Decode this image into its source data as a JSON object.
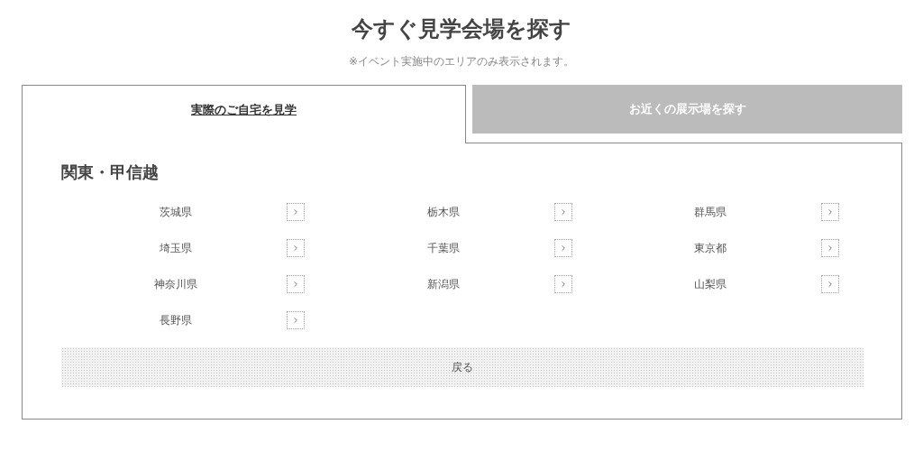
{
  "heading": "今すぐ見学会場を探す",
  "note": "※イベント実施中のエリアのみ表示されます。",
  "tabs": [
    {
      "label": "実際のご自宅を見学",
      "selected": true
    },
    {
      "label": "お近くの展示場を探す",
      "selected": false
    }
  ],
  "region": "関東・甲信越",
  "prefectures": [
    "茨城県",
    "栃木県",
    "群馬県",
    "埼玉県",
    "千葉県",
    "東京都",
    "神奈川県",
    "新潟県",
    "山梨県",
    "長野県"
  ],
  "back_button": "戻る"
}
